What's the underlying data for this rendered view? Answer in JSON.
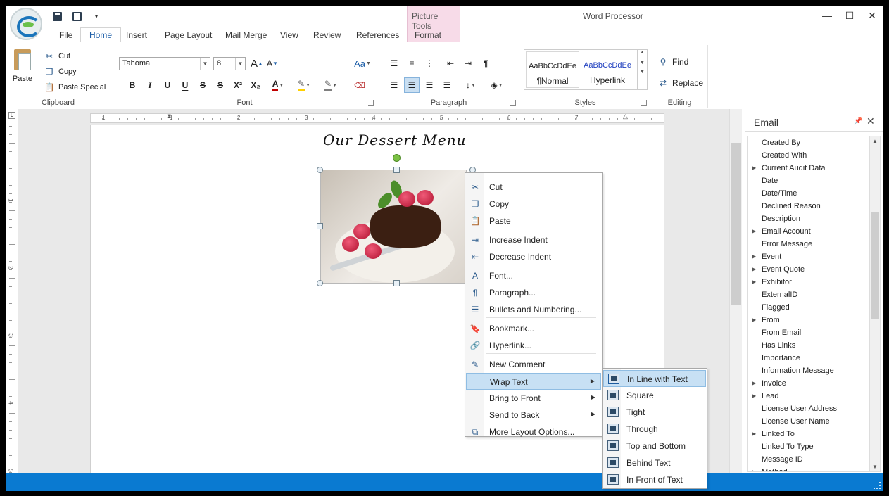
{
  "window": {
    "title": "Word Processor",
    "context_tab_group": "Picture Tools"
  },
  "tabs": [
    {
      "label": "File"
    },
    {
      "label": "Home"
    },
    {
      "label": "Insert"
    },
    {
      "label": "Page Layout"
    },
    {
      "label": "Mail Merge"
    },
    {
      "label": "View"
    },
    {
      "label": "Review"
    },
    {
      "label": "References"
    },
    {
      "label": "Format"
    }
  ],
  "active_tab": "Home",
  "ribbon": {
    "clipboard": {
      "group_label": "Clipboard",
      "paste": "Paste",
      "cut": "Cut",
      "copy": "Copy",
      "paste_special": "Paste Special"
    },
    "font": {
      "group_label": "Font",
      "font_name": "Tahoma",
      "font_size": "8",
      "grow": "A",
      "shrink": "A",
      "change_case": "Aa",
      "bold": "B",
      "italic": "I",
      "underline": "U",
      "double_underline": "U",
      "strike": "S",
      "double_strike": "S",
      "superscript": "X²",
      "subscript": "X₂",
      "font_color": "A"
    },
    "paragraph": {
      "group_label": "Paragraph",
      "pilcrow": "¶"
    },
    "styles": {
      "group_label": "Styles",
      "items": [
        {
          "sample": "AaBbCcDdEe",
          "name": "¶Normal"
        },
        {
          "sample": "AaBbCcDdEe",
          "name": "Hyperlink"
        }
      ],
      "hyperlink_color": "#1f3fbf"
    },
    "editing": {
      "group_label": "Editing",
      "find": "Find",
      "replace": "Replace"
    }
  },
  "document": {
    "title": "Our Dessert Menu",
    "ruler_h_numbers": [
      "1",
      "1",
      "2",
      "3",
      "4",
      "5",
      "6",
      "7"
    ],
    "ruler_v_numbers": [
      "1",
      "2",
      "3",
      "4",
      "5"
    ]
  },
  "context_menu": {
    "items": [
      {
        "label": "Cut",
        "icon": "scissors-icon"
      },
      {
        "label": "Copy",
        "icon": "copy-icon"
      },
      {
        "label": "Paste",
        "icon": "paste-icon"
      },
      {
        "label": "Increase Indent",
        "icon": "increase-indent-icon"
      },
      {
        "label": "Decrease Indent",
        "icon": "decrease-indent-icon"
      },
      {
        "label": "Font...",
        "icon": "font-icon"
      },
      {
        "label": "Paragraph...",
        "icon": "paragraph-icon"
      },
      {
        "label": "Bullets and Numbering...",
        "icon": "bullets-icon"
      },
      {
        "label": "Bookmark...",
        "icon": "bookmark-icon"
      },
      {
        "label": "Hyperlink...",
        "icon": "hyperlink-icon"
      },
      {
        "label": "New Comment",
        "icon": "comment-icon"
      },
      {
        "label": "Wrap Text",
        "icon": "",
        "submenu": true,
        "highlighted": true
      },
      {
        "label": "Bring to Front",
        "icon": "",
        "submenu": true
      },
      {
        "label": "Send to Back",
        "icon": "",
        "submenu": true
      },
      {
        "label": "More Layout Options...",
        "icon": "layout-options-icon"
      }
    ]
  },
  "wrap_submenu": {
    "items": [
      {
        "label": "In Line with Text",
        "highlighted": true
      },
      {
        "label": "Square"
      },
      {
        "label": "Tight"
      },
      {
        "label": "Through"
      },
      {
        "label": "Top and Bottom"
      },
      {
        "label": "Behind Text"
      },
      {
        "label": "In Front of Text"
      }
    ]
  },
  "panel": {
    "title": "Email",
    "items": [
      {
        "label": "Created By",
        "expandable": false
      },
      {
        "label": "Created With",
        "expandable": false
      },
      {
        "label": "Current Audit Data",
        "expandable": true
      },
      {
        "label": "Date",
        "expandable": false
      },
      {
        "label": "Date/Time",
        "expandable": false
      },
      {
        "label": "Declined Reason",
        "expandable": false
      },
      {
        "label": "Description",
        "expandable": false
      },
      {
        "label": "Email Account",
        "expandable": true
      },
      {
        "label": "Error Message",
        "expandable": false
      },
      {
        "label": "Event",
        "expandable": true
      },
      {
        "label": "Event Quote",
        "expandable": true
      },
      {
        "label": "Exhibitor",
        "expandable": true
      },
      {
        "label": "ExternalID",
        "expandable": false
      },
      {
        "label": "Flagged",
        "expandable": false
      },
      {
        "label": "From",
        "expandable": true
      },
      {
        "label": "From Email",
        "expandable": false
      },
      {
        "label": "Has Links",
        "expandable": false
      },
      {
        "label": "Importance",
        "expandable": false
      },
      {
        "label": "Information Message",
        "expandable": false
      },
      {
        "label": "Invoice",
        "expandable": true
      },
      {
        "label": "Lead",
        "expandable": true
      },
      {
        "label": "License User Address",
        "expandable": false
      },
      {
        "label": "License User Name",
        "expandable": false
      },
      {
        "label": "Linked To",
        "expandable": true
      },
      {
        "label": "Linked To Type",
        "expandable": false
      },
      {
        "label": "Message ID",
        "expandable": false
      },
      {
        "label": "Method",
        "expandable": true
      }
    ]
  },
  "colors": {
    "accent": "#1e5fa8",
    "status_bar": "#0a7ad1",
    "context_tab": "#f7dbe8",
    "menu_highlight": "#c7e0f4"
  }
}
